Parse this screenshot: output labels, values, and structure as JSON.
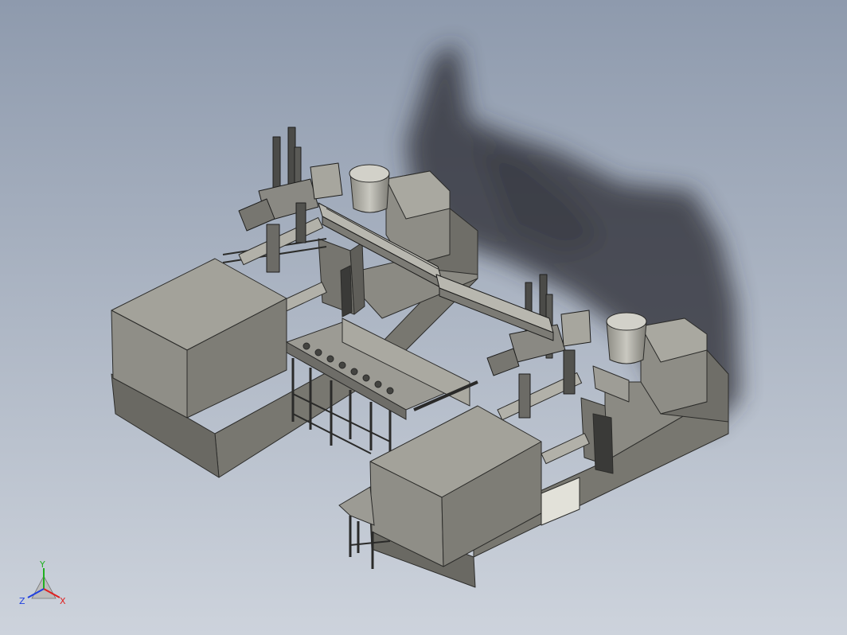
{
  "viewport": {
    "background_top": "#8e9aad",
    "background_bottom": "#cdd3dc"
  },
  "model": {
    "subject": "injection-molding-line",
    "machines": 2,
    "robots": 2,
    "hoppers": 2,
    "conveyors": 2
  },
  "triad": {
    "x_label": "X",
    "y_label": "Y",
    "z_label": "Z",
    "x_color": "#e02020",
    "y_color": "#20b020",
    "z_color": "#2040e0"
  }
}
